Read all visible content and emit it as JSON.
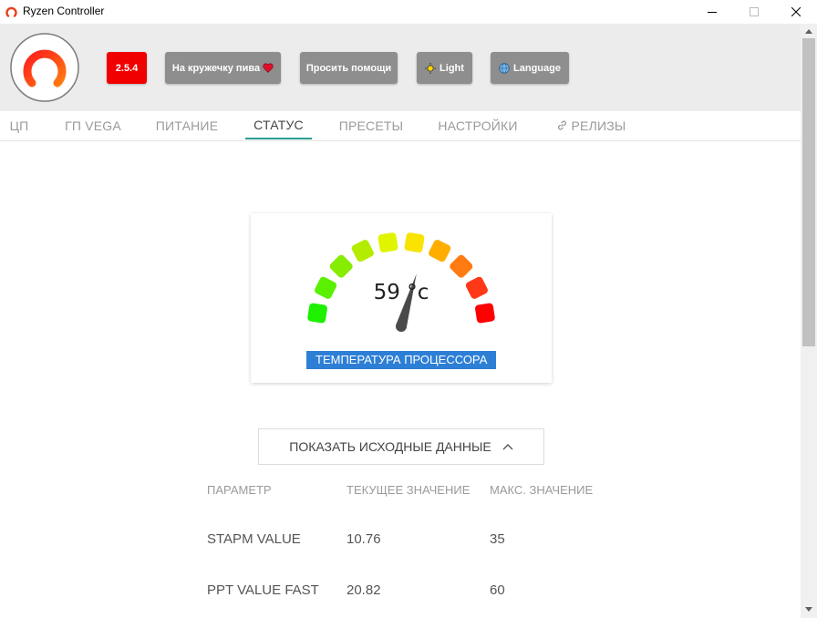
{
  "window": {
    "title": "Ryzen Controller"
  },
  "header": {
    "version": "2.5.4",
    "donate_label": "На кружечку пива",
    "help_label": "Просить помощи",
    "theme_label": "Light",
    "language_label": "Language",
    "colors": {
      "version_bg": "#f00000",
      "button_bg": "#8e8e8e"
    }
  },
  "tabs": [
    {
      "label": "ЦП"
    },
    {
      "label": "ГП VEGA"
    },
    {
      "label": "ПИТАНИЕ"
    },
    {
      "label": "СТАТУС",
      "active": true
    },
    {
      "label": "ПРЕСЕТЫ"
    },
    {
      "label": "НАСТРОЙКИ"
    },
    {
      "label": "РЕЛИЗЫ",
      "icon": "link-icon"
    }
  ],
  "gauge": {
    "value_text": "59 °c",
    "value": 59,
    "min": 0,
    "max": 100,
    "label": "ТЕМПЕРАТУРА ПРОЦЕССОРА",
    "segment_colors": [
      "#1ef000",
      "#5af000",
      "#86ec00",
      "#b4ec00",
      "#e0f400",
      "#f8e400",
      "#ffae00",
      "#ff7a10",
      "#ff3818",
      "#ff0000"
    ],
    "needle_color": "#4a4a4a"
  },
  "raw_toggle": {
    "label": "ПОКАЗАТЬ ИСХОДНЫЕ ДАННЫЕ",
    "expanded": true
  },
  "table": {
    "headers": [
      "ПАРАМЕТР",
      "ТЕКУЩЕЕ ЗНАЧЕНИЕ",
      "МАКС. ЗНАЧЕНИЕ"
    ],
    "rows": [
      [
        "STAPM VALUE",
        "10.76",
        "35"
      ],
      [
        "PPT VALUE FAST",
        "20.82",
        "60"
      ]
    ]
  }
}
